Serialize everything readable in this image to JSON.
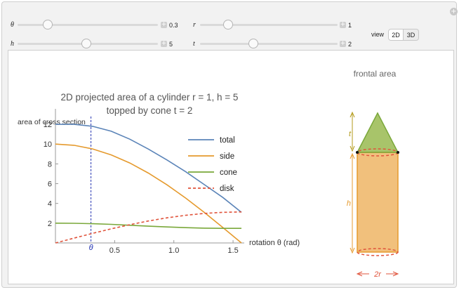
{
  "controls": {
    "theta": {
      "label": "θ",
      "value": "0.3"
    },
    "r": {
      "label": "r",
      "value": "1"
    },
    "h": {
      "label": "h",
      "value": "5"
    },
    "t": {
      "label": "t",
      "value": "2"
    },
    "view": {
      "label": "view",
      "options": [
        "2D",
        "3D"
      ],
      "selected": "2D"
    }
  },
  "plot_title_line1": "2D projected area of a cylinder r = 1, h = 5",
  "plot_title_line2": "topped by cone t = 2",
  "frontal": {
    "title": "frontal area",
    "label_t": "t",
    "label_h": "h",
    "label_2r": "2r"
  },
  "colors": {
    "total": "#5b84b8",
    "side": "#e59a2d",
    "cone": "#7aa83a",
    "disk": "#e0533b",
    "marker": "#1f2fb0"
  },
  "chart_data": {
    "type": "line",
    "title": "2D projected area of a cylinder r = 1, h = 5 topped by cone t = 2",
    "ylabel": "area of cross section",
    "xlabel": "rotation θ (rad)",
    "xlim": [
      0,
      1.5708
    ],
    "ylim": [
      0,
      13
    ],
    "x_ticks": [
      "0.5",
      "1.0",
      "1.5"
    ],
    "y_ticks": [
      "2",
      "4",
      "6",
      "8",
      "10",
      "12"
    ],
    "marker": {
      "x": 0.3,
      "label": "θ"
    },
    "x": [
      0,
      0.157,
      0.314,
      0.471,
      0.628,
      0.785,
      0.942,
      1.1,
      1.257,
      1.414,
      1.571
    ],
    "series": [
      {
        "name": "total",
        "values": [
          12.0,
          12.0,
          11.8,
          11.3,
          10.5,
          9.5,
          8.4,
          7.2,
          5.9,
          4.6,
          3.1
        ]
      },
      {
        "name": "side",
        "values": [
          10.0,
          9.88,
          9.51,
          8.91,
          8.09,
          7.07,
          5.88,
          4.54,
          3.09,
          1.56,
          0.0
        ]
      },
      {
        "name": "cone",
        "values": [
          2.0,
          1.99,
          1.95,
          1.88,
          1.79,
          1.7,
          1.62,
          1.55,
          1.5,
          1.48,
          1.48
        ]
      },
      {
        "name": "disk",
        "values": [
          0.0,
          0.49,
          0.97,
          1.43,
          1.85,
          2.22,
          2.54,
          2.8,
          2.99,
          3.1,
          3.14
        ]
      }
    ],
    "legend": [
      "total",
      "side",
      "cone",
      "disk"
    ],
    "legend_position": "top-right"
  }
}
